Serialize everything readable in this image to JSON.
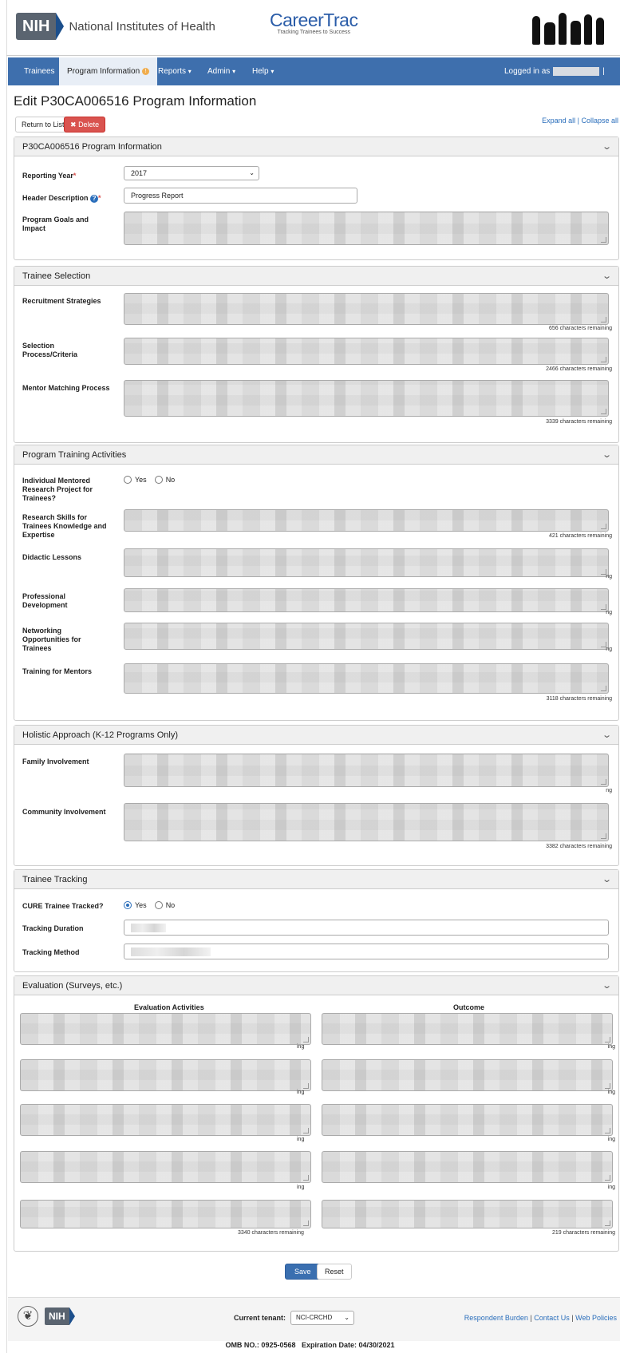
{
  "header": {
    "nih_abbr": "NIH",
    "nih_name": "National Institutes of Health",
    "app_title": "CareerTrac",
    "app_tagline": "Tracking Trainees to Success"
  },
  "nav": {
    "items": [
      {
        "label": "Trainees"
      },
      {
        "label": "Program Information"
      },
      {
        "label": "Reports"
      },
      {
        "label": "Admin"
      },
      {
        "label": "Help"
      }
    ],
    "logged_in": "Logged in as",
    "logout": "| Logout",
    "accent": "#3e6fad"
  },
  "page": {
    "title": "Edit P30CA006516 Program Information",
    "return_label": "Return to List",
    "delete_label": "Delete",
    "expand_all": "Expand all",
    "collapse_all": "Collapse all"
  },
  "program_info": {
    "heading": "P30CA006516 Program Information",
    "reporting_year_label": "Reporting Year",
    "reporting_year_value": "2017",
    "header_desc_label": "Header Description",
    "header_desc_value": "Progress Report",
    "goals_label": "Program Goals and Impact"
  },
  "trainee_selection": {
    "heading": "Trainee Selection",
    "recruitment_label": "Recruitment Strategies",
    "recruitment_remaining": "656 characters remaining",
    "selection_label": "Selection Process/Criteria",
    "selection_remaining": "2466 characters remaining",
    "mentor_label": "Mentor Matching Process",
    "mentor_remaining": "3339 characters remaining"
  },
  "training_activities": {
    "heading": "Program Training Activities",
    "mentored_label": "Individual Mentored Research Project for Trainees?",
    "yes": "Yes",
    "no": "No",
    "skills_label": "Research Skills for Trainees Knowledge and Expertise",
    "skills_remaining": "421 characters remaining",
    "didactic_label": "Didactic Lessons",
    "prof_dev_label": "Professional Development",
    "networking_label": "Networking Opportunities for Trainees",
    "mentors_training_label": "Training for Mentors",
    "mentors_remaining": "3118 characters remaining",
    "partial_suffix": "ng"
  },
  "holistic": {
    "heading": "Holistic Approach (K-12 Programs Only)",
    "family_label": "Family Involvement",
    "community_label": "Community Involvement",
    "community_remaining": "3382 characters remaining",
    "partial_suffix": "ng"
  },
  "tracking": {
    "heading": "Trainee Tracking",
    "cure_label": "CURE Trainee Tracked?",
    "yes": "Yes",
    "no": "No",
    "cure_selected": "Yes",
    "duration_label": "Tracking Duration",
    "method_label": "Tracking Method"
  },
  "evaluation": {
    "heading": "Evaluation (Surveys, etc.)",
    "col_activities": "Evaluation Activities",
    "col_outcome": "Outcome",
    "partial_suffix": "ing",
    "activities_remaining": "3340 characters remaining",
    "outcome_remaining": "219 characters remaining"
  },
  "actions": {
    "save": "Save",
    "reset": "Reset"
  },
  "footer": {
    "nih_abbr": "NIH",
    "tenant_label": "Current tenant:",
    "tenant_value": "NCI-CRCHD",
    "respondent_burden": "Respondent Burden",
    "contact_us": "Contact Us",
    "web_policies": "Web Policies",
    "sep": "|",
    "omb": "OMB NO.: 0925-0568",
    "expiration": "Expiration Date: 04/30/2021"
  }
}
